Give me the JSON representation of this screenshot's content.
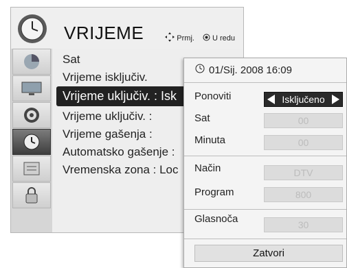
{
  "menu": {
    "title": "VRIJEME",
    "hints": {
      "move": "Prmj.",
      "ok": "U redu"
    },
    "sidebar": [
      {
        "icon": "picture-icon"
      },
      {
        "icon": "screen-icon"
      },
      {
        "icon": "audio-icon"
      },
      {
        "icon": "clock-icon",
        "active": true
      },
      {
        "icon": "option-icon"
      },
      {
        "icon": "lock-icon"
      }
    ],
    "items": [
      "Sat",
      "Vrijeme isključiv.",
      "Vrijeme uključiv.  : Isk",
      "Vrijeme uključiv.       :",
      "Vrijeme gašenja         :",
      "Automatsko gašenje :",
      "Vremenska zona  : Loc"
    ],
    "selected_index": 2
  },
  "popup": {
    "datetime": "01/Sij. 2008 16:09",
    "rows": [
      {
        "label": "Ponoviti",
        "value": "Isključeno",
        "active": true
      },
      {
        "label": "Sat",
        "value": "00"
      },
      {
        "label": "Minuta",
        "value": "00"
      },
      {
        "label": "Način",
        "value": "DTV"
      },
      {
        "label": "Program",
        "value": "800"
      },
      {
        "label": "Glasnoča",
        "value": "30"
      }
    ],
    "close_label": "Zatvori"
  }
}
